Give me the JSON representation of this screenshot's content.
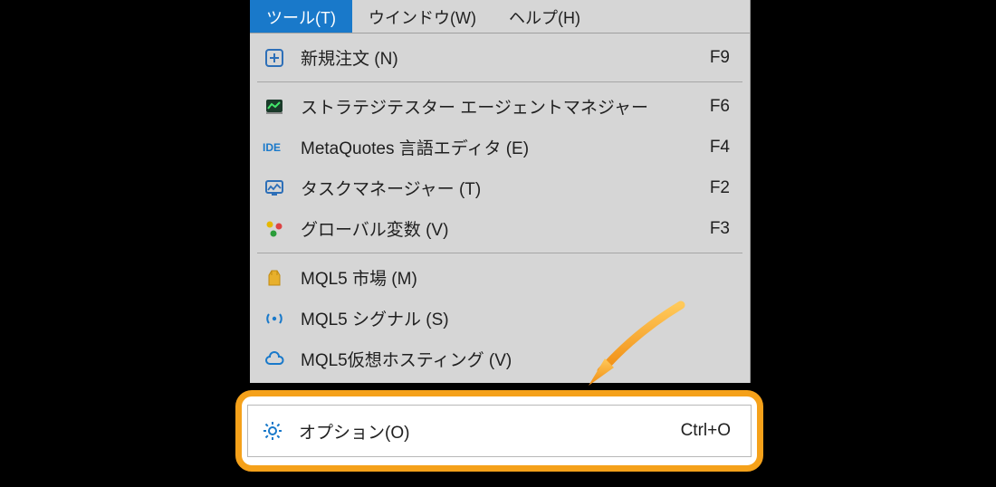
{
  "menubar": {
    "items": [
      {
        "label": "ツール(T)",
        "active": true
      },
      {
        "label": "ウインドウ(W)",
        "active": false
      },
      {
        "label": "ヘルプ(H)",
        "active": false
      }
    ]
  },
  "menu": {
    "groups": [
      [
        {
          "icon": "new-order-icon",
          "label": "新規注文 (N)",
          "shortcut": "F9"
        }
      ],
      [
        {
          "icon": "strategy-tester-icon",
          "label": "ストラテジテスター エージェントマネジャー",
          "shortcut": "F6"
        },
        {
          "icon": "ide-icon",
          "label": "MetaQuotes 言語エディタ (E)",
          "shortcut": "F4"
        },
        {
          "icon": "task-manager-icon",
          "label": "タスクマネージャー (T)",
          "shortcut": "F2"
        },
        {
          "icon": "global-variables-icon",
          "label": "グローバル変数 (V)",
          "shortcut": "F3"
        }
      ],
      [
        {
          "icon": "market-icon",
          "label": "MQL5 市場 (M)",
          "shortcut": ""
        },
        {
          "icon": "signals-icon",
          "label": "MQL5 シグナル (S)",
          "shortcut": ""
        },
        {
          "icon": "cloud-icon",
          "label": "MQL5仮想ホスティング (V)",
          "shortcut": ""
        }
      ]
    ]
  },
  "highlighted": {
    "icon": "options-icon",
    "label": "オプション(O)",
    "shortcut": "Ctrl+O"
  },
  "colors": {
    "accent": "#1979ca",
    "highlight": "#f5a11a"
  }
}
